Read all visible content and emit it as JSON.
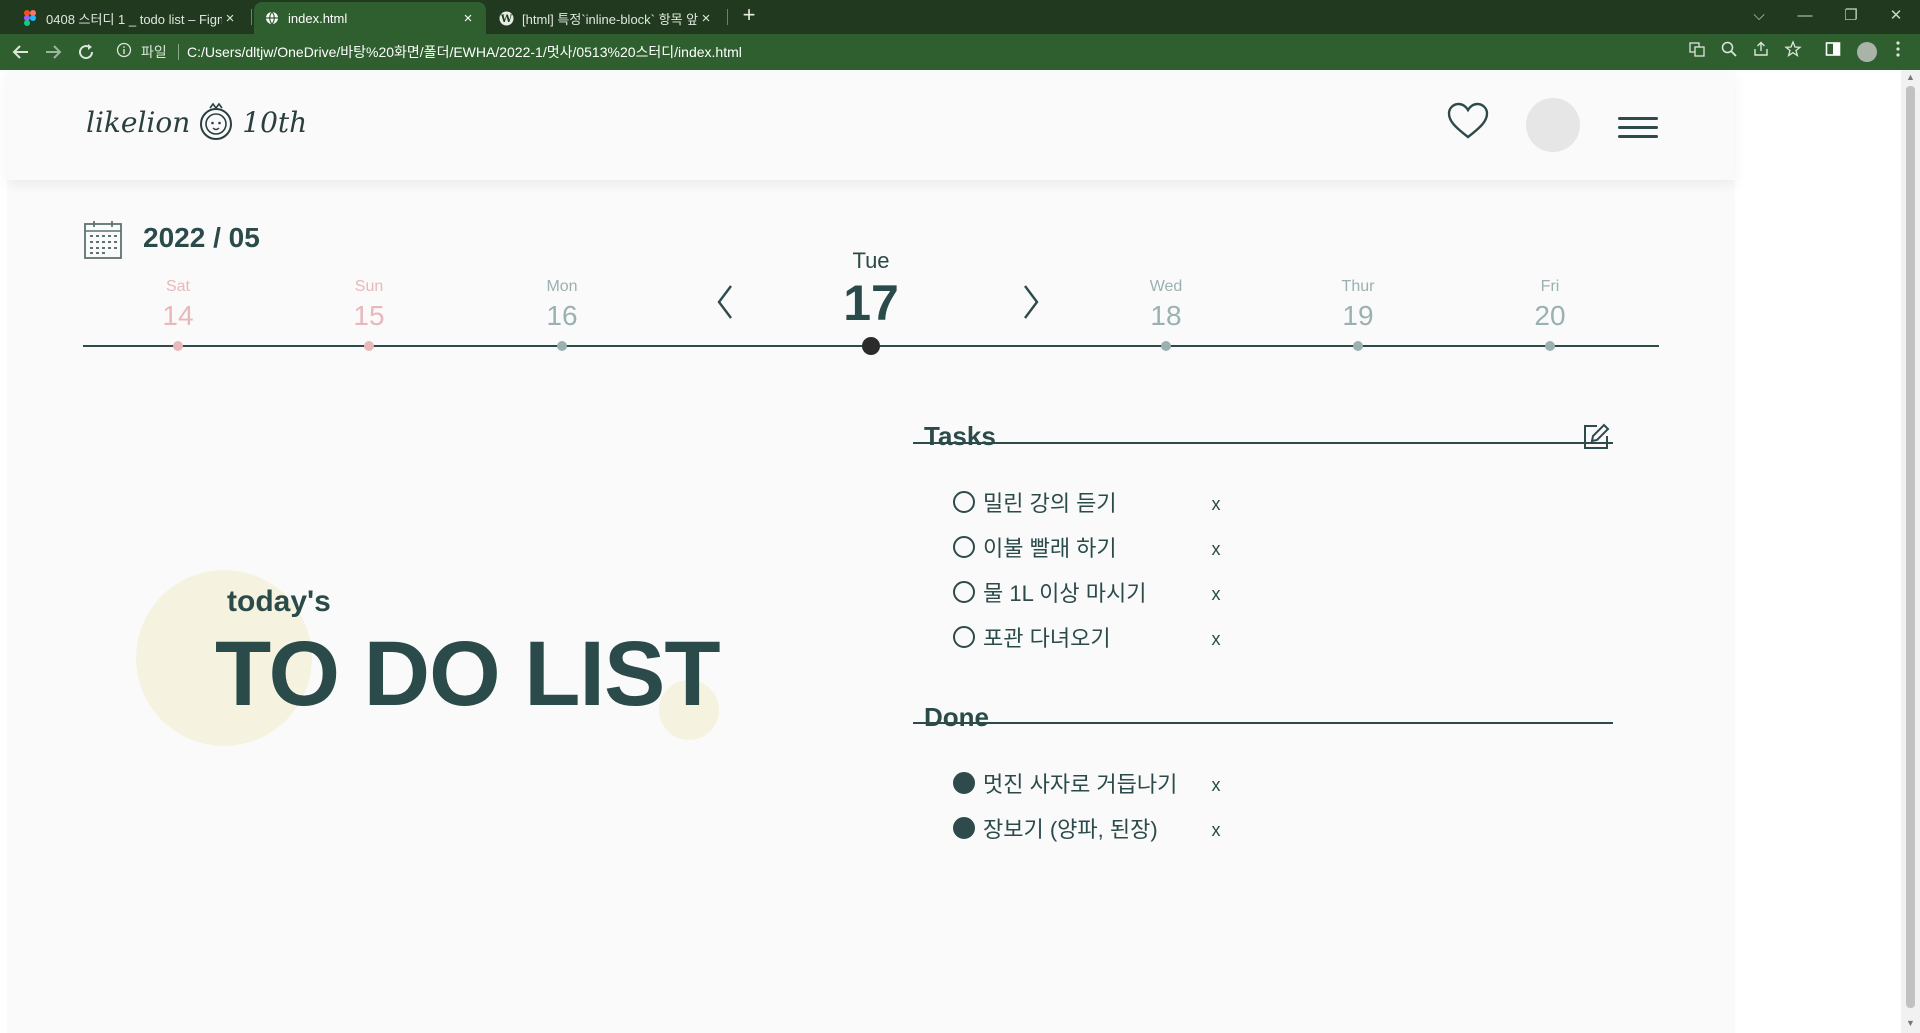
{
  "browser": {
    "tabs": [
      {
        "title": "0408 스터디 1 _ todo list – Figma",
        "close": "×"
      },
      {
        "title": "index.html",
        "close": "×"
      },
      {
        "title": "[html] 특정`inline-block` 항목 앞",
        "close": "×"
      }
    ],
    "new_tab": "+",
    "address": {
      "scheme_label": "파일",
      "url": "C:/Users/dltjw/OneDrive/바탕%20화면/폴더/EWHA/2022-1/멋사/0513%20스터디/index.html"
    },
    "window_controls": [
      "⌵",
      "—",
      "❐",
      "✕"
    ]
  },
  "header": {
    "logo_left": "likelion",
    "logo_right": "10th"
  },
  "calendar": {
    "month": "2022 / 05",
    "days": [
      {
        "name": "Sat",
        "num": "14",
        "kind": "weekend"
      },
      {
        "name": "Sun",
        "num": "15",
        "kind": "weekend"
      },
      {
        "name": "Mon",
        "num": "16",
        "kind": "weekday"
      },
      {
        "name": "Tue",
        "num": "17",
        "kind": "today"
      },
      {
        "name": "Wed",
        "num": "18",
        "kind": "weekday"
      },
      {
        "name": "Thur",
        "num": "19",
        "kind": "weekday"
      },
      {
        "name": "Fri",
        "num": "20",
        "kind": "weekday"
      }
    ]
  },
  "hero": {
    "subtitle": "today's",
    "title": "TO DO LIST"
  },
  "tasks": {
    "title": "Tasks",
    "items": [
      {
        "label": "밀린 강의 듣기",
        "delete": "x"
      },
      {
        "label": "이불 빨래 하기",
        "delete": "x"
      },
      {
        "label": "물 1L 이상 마시기",
        "delete": "x"
      },
      {
        "label": "포관 다녀오기",
        "delete": "x"
      }
    ]
  },
  "done": {
    "title": "Done",
    "items": [
      {
        "label": "멋진 사자로 거듭나기",
        "delete": "x"
      },
      {
        "label": "장보기 (양파, 된장)",
        "delete": "x"
      }
    ]
  },
  "colors": {
    "primary": "#2e4a4a",
    "weekend": "#e8b8bb",
    "weekday": "#9bb1b1",
    "accent_blob": "#f5f3df",
    "chrome_tabbar": "#213a1f",
    "chrome_toolbar": "#2f5e2f"
  }
}
